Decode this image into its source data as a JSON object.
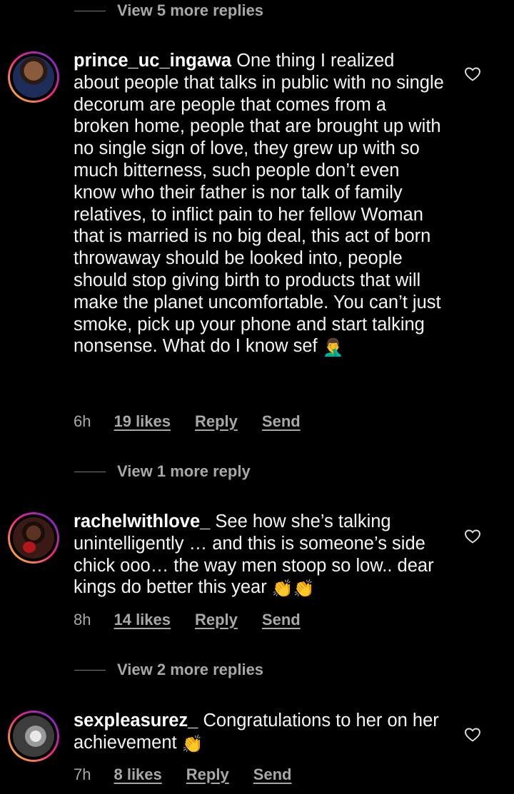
{
  "thread": {
    "view_more_top": "View 5 more replies",
    "view_more_middle": "View 1 more reply",
    "view_more_bottom": "View 2 more replies"
  },
  "comments": [
    {
      "username": "prince_uc_ingawa",
      "text": "One thing I realized about people that talks in public with no single decorum are people that comes from a broken home, people that are brought up with no single sign of love, they grew up with so much bitterness, such people don’t even know who their father is nor talk of family relatives, to inflict pain to her fellow Woman that is married is no big deal, this act of born throwaway should be looked into, people should stop giving birth to products that will make the planet uncomfortable. You can’t just smoke, pick up your phone and start talking nonsense. What do I know sef",
      "emoji": "🤦‍♂️",
      "time": "6h",
      "likes": "19 likes",
      "reply": "Reply",
      "send": "Send"
    },
    {
      "username": "rachelwithlove_",
      "text": "See how she’s talking unintelligently … and this is someone’s side chick ooo… the way men stoop so low.. dear kings do better this year",
      "emoji": "👏👏",
      "time": "8h",
      "likes": "14 likes",
      "reply": "Reply",
      "send": "Send"
    },
    {
      "username": "sexpleasurez_",
      "text": "Congratulations to her on her achievement",
      "emoji": "👏",
      "time": "7h",
      "likes": "8 likes",
      "reply": "Reply",
      "send": "Send"
    }
  ],
  "icons": {
    "like": "heart-outline-icon",
    "reaction": "clapping-hands-emoji"
  },
  "colors": {
    "background": "#000000",
    "secondary_text": "#a8a8a8",
    "primary_text": "#ffffff"
  }
}
